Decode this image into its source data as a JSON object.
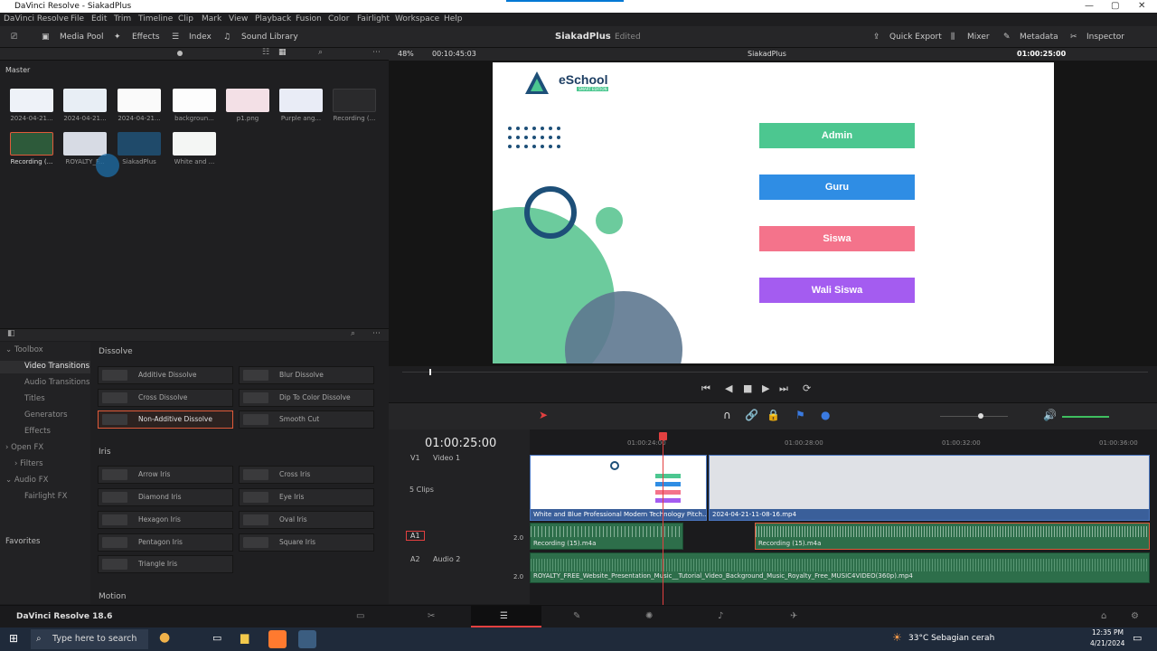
{
  "window_title": "DaVinci Resolve - SiakadPlus",
  "menu": [
    "DaVinci Resolve",
    "File",
    "Edit",
    "Trim",
    "Timeline",
    "Clip",
    "Mark",
    "View",
    "Playback",
    "Fusion",
    "Color",
    "Fairlight",
    "Workspace",
    "Help"
  ],
  "toolbar": {
    "media_pool": "Media Pool",
    "effects": "Effects",
    "index": "Index",
    "sound_library": "Sound Library",
    "project_name": "SiakadPlus",
    "edited": "Edited",
    "quick_export": "Quick Export",
    "mixer": "Mixer",
    "metadata": "Metadata",
    "inspector": "Inspector"
  },
  "media_pool": {
    "bin": "Master",
    "items": [
      {
        "label": "2024-04-21..."
      },
      {
        "label": "2024-04-21..."
      },
      {
        "label": "2024-04-21..."
      },
      {
        "label": "backgroun..."
      },
      {
        "label": "p1.png"
      },
      {
        "label": "Purple ang..."
      },
      {
        "label": "Recording (..."
      },
      {
        "label": "Recording (..."
      },
      {
        "label": "ROYALTY_F..."
      },
      {
        "label": "SiakadPlus"
      },
      {
        "label": "White and ..."
      }
    ]
  },
  "effects_sidebar": {
    "toolbox": "Toolbox",
    "items": [
      "Video Transitions",
      "Audio Transitions",
      "Titles",
      "Generators",
      "Effects"
    ],
    "open_fx": "Open FX",
    "filters": "Filters",
    "audio_fx": "Audio FX",
    "fairlight_fx": "Fairlight FX",
    "favorites": "Favorites"
  },
  "effects_panel": {
    "dissolve_header": "Dissolve",
    "dissolve": [
      "Additive Dissolve",
      "Blur Dissolve",
      "Cross Dissolve",
      "Dip To Color Dissolve",
      "Non-Additive Dissolve",
      "Smooth Cut"
    ],
    "iris_header": "Iris",
    "iris": [
      "Arrow Iris",
      "Cross Iris",
      "Diamond Iris",
      "Eye Iris",
      "Hexagon Iris",
      "Oval Iris",
      "Pentagon Iris",
      "Square Iris",
      "Triangle Iris"
    ],
    "motion_header": "Motion"
  },
  "viewer": {
    "zoom": "48%",
    "duration": "00:10:45:03",
    "timeline_name": "SiakadPlus",
    "timecode": "01:00:25:00"
  },
  "slide": {
    "logo_text": "eSchool",
    "logo_sub": "SMART EDITION",
    "buttons": [
      {
        "label": "Admin",
        "color": "#4cc790"
      },
      {
        "label": "Guru",
        "color": "#2f8de4"
      },
      {
        "label": "Siswa",
        "color": "#f4738b"
      },
      {
        "label": "Wali Siswa",
        "color": "#a45cf0"
      }
    ]
  },
  "timeline": {
    "timecode": "01:00:25:00",
    "ruler": [
      "01:00:24:00",
      "01:00:28:00",
      "01:00:32:00",
      "01:00:36:00"
    ],
    "v1_name": "Video 1",
    "v1_clips_count": "5 Clips",
    "v1_clip_a": "White and Blue Professional Modern Technology Pitch...",
    "v1_clip_b": "2024-04-21-11-08-16.mp4",
    "a1_id": "A1",
    "a1_level": "2.0",
    "a1_clip_a": "Recording (15).m4a",
    "a1_clip_b": "Recording (15).m4a",
    "a2_id": "A2",
    "a2_name": "Audio 2",
    "a2_level": "2.0",
    "a2_clip": "ROYALTY_FREE_Website_Presentation_Music__Tutorial_Video_Background_Music_Royalty_Free_MUSIC4VIDEO(360p).mp4"
  },
  "page_bar": {
    "brand": "DaVinci Resolve 18.6"
  },
  "taskbar": {
    "search_placeholder": "Type here to search",
    "weather": "33°C  Sebagian cerah",
    "time": "12:35 PM",
    "date": "4/21/2024"
  },
  "colors": {
    "accent": "#e24040",
    "selection": "#e05a3a"
  }
}
